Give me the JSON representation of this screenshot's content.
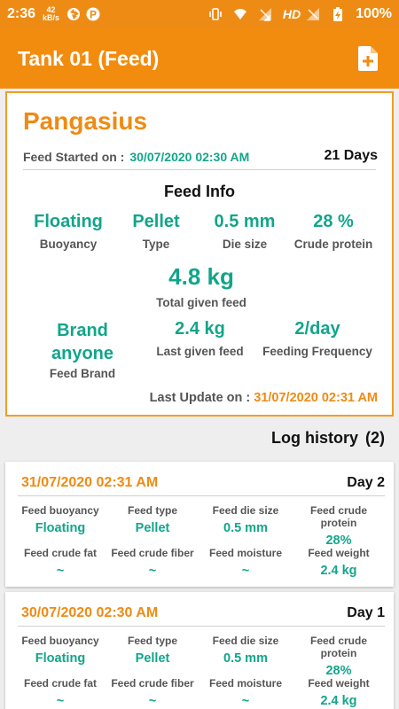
{
  "status": {
    "time": "2:36",
    "net_speed": "42",
    "net_unit": "kB/s",
    "network_label": "HD",
    "battery": "100%"
  },
  "appbar": {
    "title": "Tank 01 (Feed)",
    "action_icon": "add-document-icon"
  },
  "summary": {
    "fish": "Pangasius",
    "feed_started_label": "Feed Started on :",
    "feed_started_value": "30/07/2020 02:30 AM",
    "days": "21 Days",
    "feed_info_title": "Feed Info",
    "buoyancy_value": "Floating",
    "buoyancy_label": "Buoyancy",
    "type_value": "Pellet",
    "type_label": "Type",
    "die_value": "0.5 mm",
    "die_label": "Die size",
    "protein_value": "28 %",
    "protein_label": "Crude protein",
    "total_value": "4.8 kg",
    "total_label": "Total given feed",
    "brand_value": "Brand anyone",
    "brand_label": "Feed Brand",
    "last_value": "2.4 kg",
    "last_label": "Last given feed",
    "freq_value": "2/day",
    "freq_label": "Feeding Frequency",
    "last_update_label": "Last Update on :",
    "last_update_value": "31/07/2020 02:31 AM"
  },
  "log": {
    "title": "Log history",
    "count": "(2)",
    "entries": [
      {
        "date": "31/07/2020 02:31 AM",
        "day": "Day 2",
        "buoyancy_label": "Feed buoyancy",
        "buoyancy": "Floating",
        "type_label": "Feed type",
        "type": "Pellet",
        "die_label": "Feed die size",
        "die": "0.5 mm",
        "protein_label": "Feed crude protein",
        "protein": "28%",
        "fat_label": "Feed crude fat",
        "fat": "~",
        "fiber_label": "Feed crude fiber",
        "fiber": "~",
        "moisture_label": "Feed moisture",
        "moisture": "~",
        "weight_label": "Feed weight",
        "weight": "2.4 kg"
      },
      {
        "date": "30/07/2020 02:30 AM",
        "day": "Day 1",
        "buoyancy_label": "Feed buoyancy",
        "buoyancy": "Floating",
        "type_label": "Feed type",
        "type": "Pellet",
        "die_label": "Feed die size",
        "die": "0.5 mm",
        "protein_label": "Feed crude protein",
        "protein": "28%",
        "fat_label": "Feed crude fat",
        "fat": "~",
        "fiber_label": "Feed crude fiber",
        "fiber": "~",
        "moisture_label": "Feed moisture",
        "moisture": "~",
        "weight_label": "Feed weight",
        "weight": "2.4 kg"
      }
    ]
  }
}
